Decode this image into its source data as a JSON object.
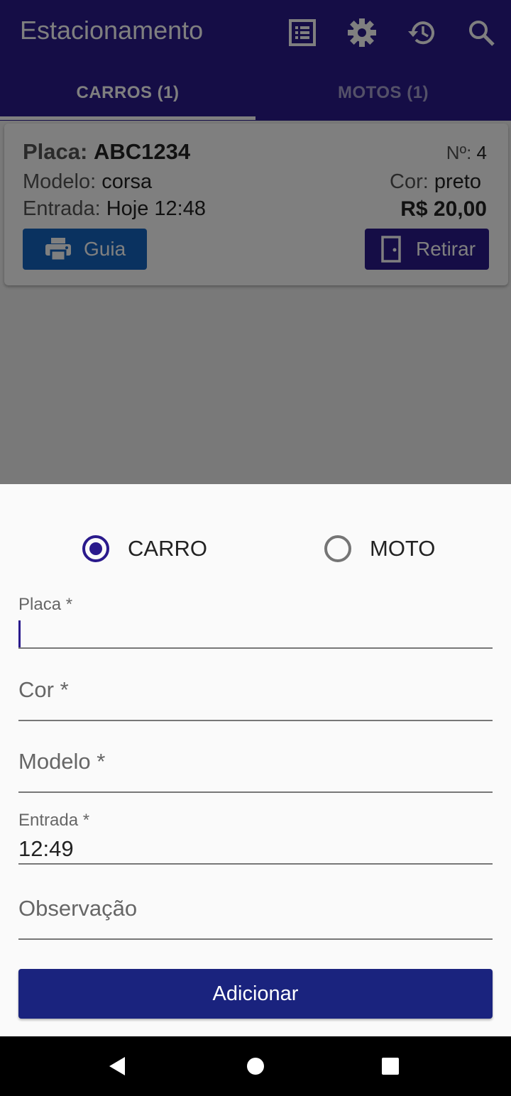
{
  "appbar": {
    "title": "Estacionamento",
    "icons": [
      "list-icon",
      "gear-icon",
      "history-icon",
      "search-icon"
    ],
    "color": "#2a1a8c"
  },
  "tabs": [
    {
      "label": "CARROS (1)",
      "active": true
    },
    {
      "label": "MOTOS (1)",
      "active": false
    }
  ],
  "card": {
    "placa_label": "Placa:",
    "placa": "ABC1234",
    "numero_label": "Nº:",
    "numero": "4",
    "modelo_label": "Modelo:",
    "modelo": "corsa",
    "cor_label": "Cor:",
    "cor": "preto",
    "entrada_label": "Entrada:",
    "entrada": "Hoje 12:48",
    "valor": "R$ 20,00",
    "guia_button": "Guia",
    "retirar_button": "Retirar"
  },
  "sheet": {
    "vehicle_types": [
      {
        "label": "CARRO",
        "selected": true
      },
      {
        "label": "MOTO",
        "selected": false
      }
    ],
    "fields": {
      "placa": {
        "label": "Placa *",
        "value": ""
      },
      "cor": {
        "label": "Cor *",
        "value": ""
      },
      "modelo": {
        "label": "Modelo *",
        "value": ""
      },
      "entrada": {
        "label": "Entrada *",
        "value": "12:49"
      },
      "observacao": {
        "label": "Observação",
        "value": ""
      }
    },
    "submit_button": "Adicionar",
    "accent": "#1a237e"
  },
  "navbar": {
    "icons": [
      "back-icon",
      "home-icon",
      "recents-icon"
    ]
  }
}
